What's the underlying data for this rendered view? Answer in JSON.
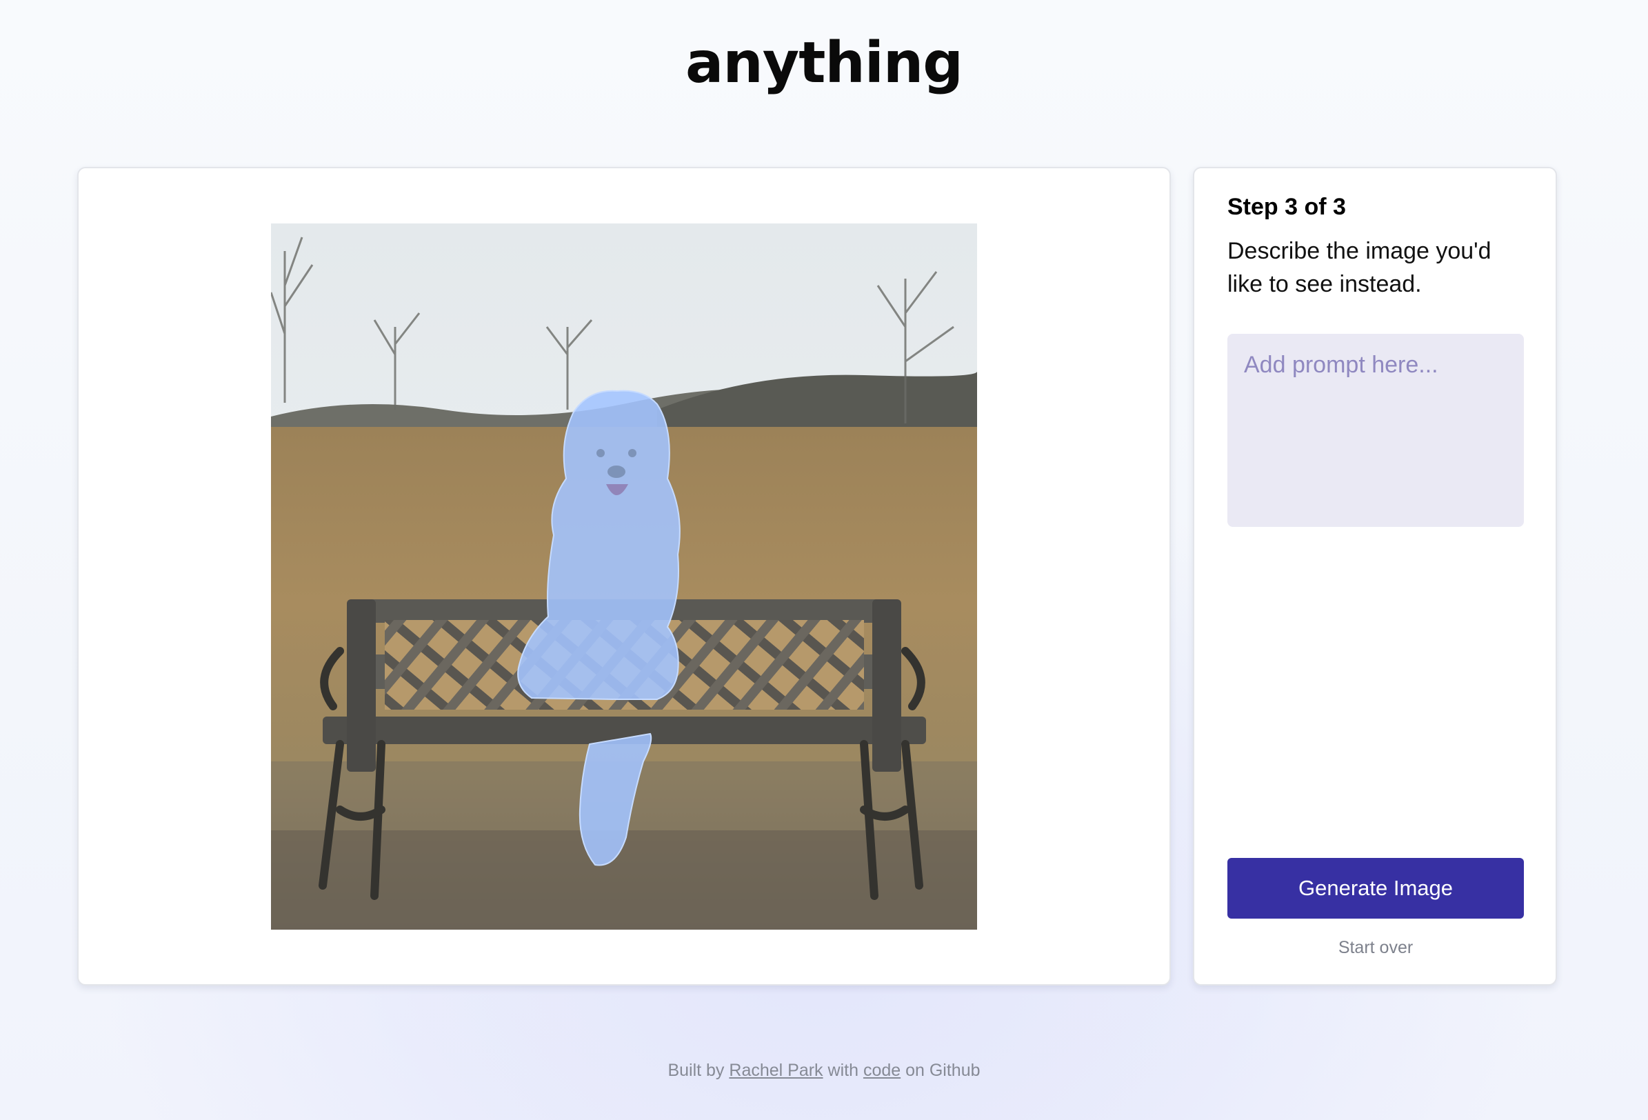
{
  "app": {
    "title": "anything"
  },
  "image_panel": {
    "image_description_icon": "photo-dog-on-bench-masked"
  },
  "step": {
    "title": "Step 3 of 3",
    "description": "Describe the image you'd like to see instead."
  },
  "prompt": {
    "value": "",
    "placeholder": "Add prompt here..."
  },
  "actions": {
    "generate_label": "Generate Image",
    "start_over_label": "Start over"
  },
  "footer": {
    "built_by": "Built by",
    "author": "Rachel Park",
    "with": "with",
    "code_link": "code",
    "on_github": "on Github"
  },
  "colors": {
    "accent": "#3730a3",
    "prompt_bg": "#eae9f4",
    "mask_overlay": "#9cbfff"
  }
}
